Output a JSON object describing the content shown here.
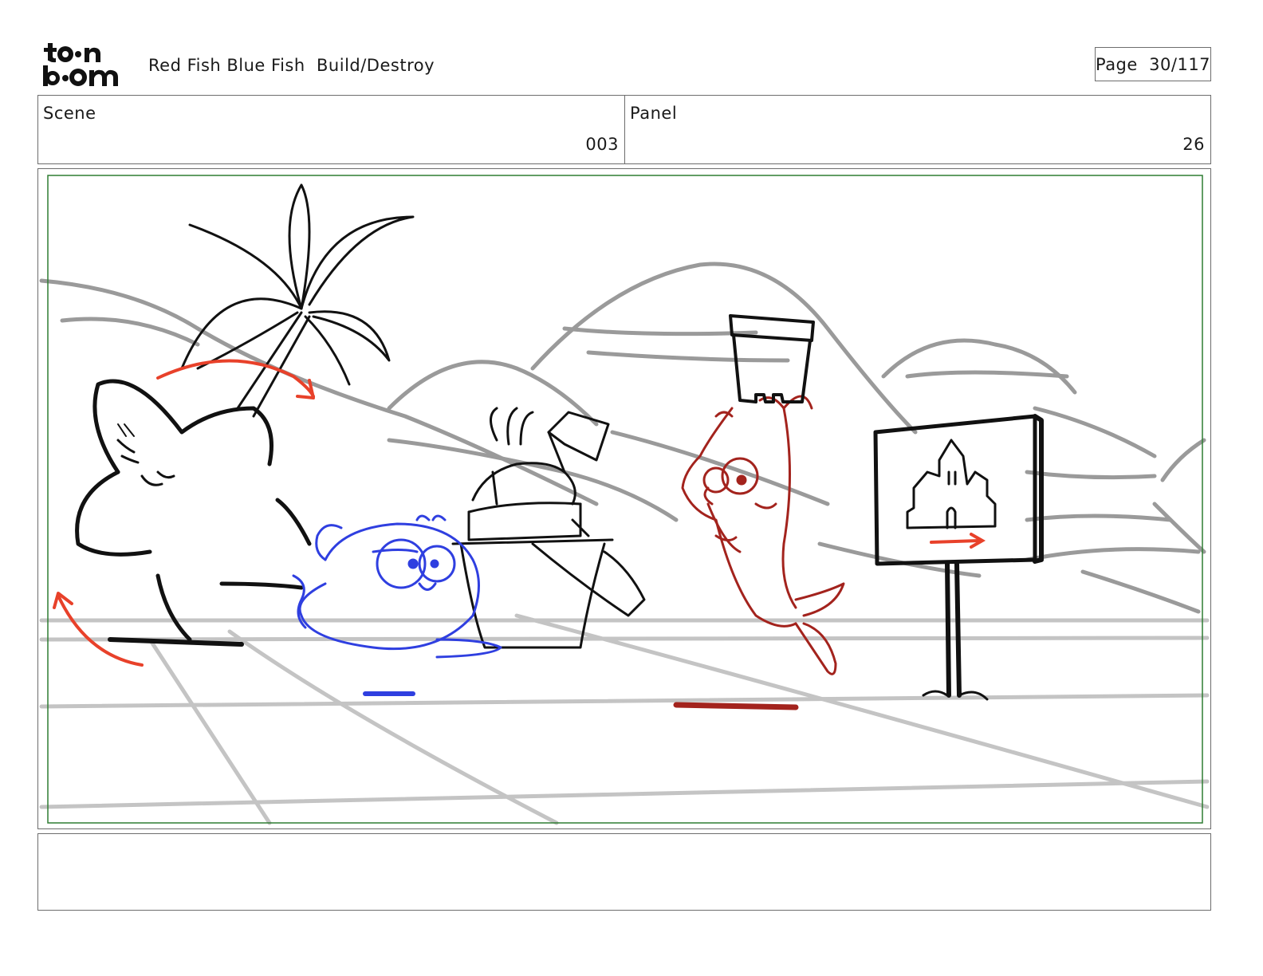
{
  "header": {
    "logo_alt": "toon boom",
    "title": "Red Fish Blue Fish  Build/Destroy",
    "page_label": "Page  30/117"
  },
  "info": {
    "scene_label": "Scene",
    "scene_value": "003",
    "panel_label": "Panel",
    "panel_value": "26"
  },
  "notes": {
    "text": ""
  },
  "colors": {
    "frame_border": "#2e7d32",
    "ink": "#111111",
    "background_sketch": "#9a9a9a",
    "floor_lines": "#c4c4c4",
    "blue_fish": "#2f3fe0",
    "red_fish": "#a3231d",
    "motion_arrows": "#e8412a"
  }
}
